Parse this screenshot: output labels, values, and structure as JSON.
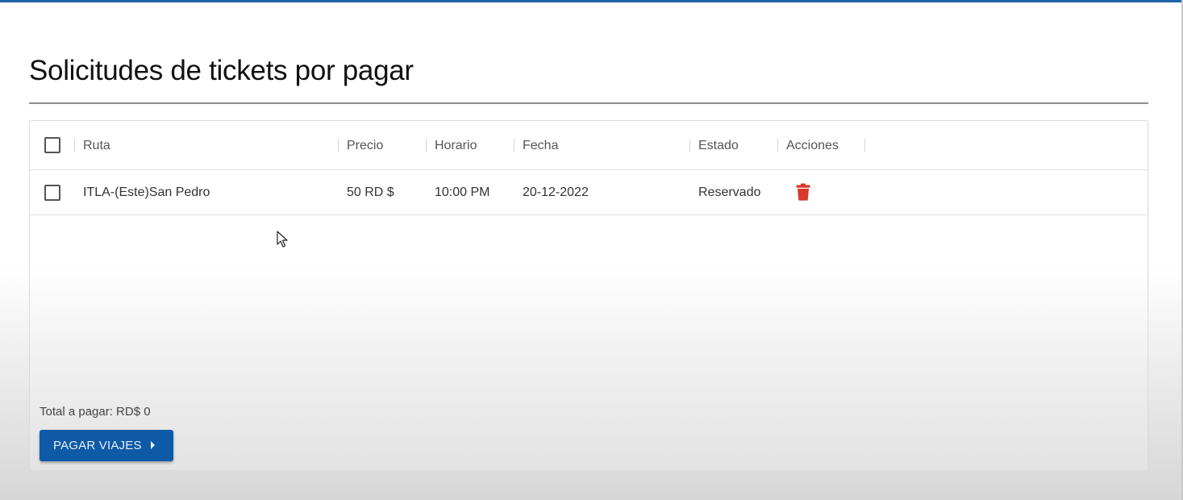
{
  "page": {
    "title": "Solicitudes de tickets por pagar"
  },
  "table": {
    "columns": [
      "Ruta",
      "Precio",
      "Horario",
      "Fecha",
      "Estado",
      "Acciones"
    ],
    "rows": [
      {
        "ruta": "ITLA-(Este)San Pedro",
        "precio": "50 RD $",
        "horario": "10:00 PM",
        "fecha": "20-12-2022",
        "estado": "Reservado",
        "action_icon": "trash-icon"
      }
    ]
  },
  "footer": {
    "total_label": "Total a pagar: RD$ 0",
    "pay_button_label": "PAGAR VIAJES",
    "pay_button_icon": "caret-right-icon"
  },
  "colors": {
    "accent": "#1f62a8",
    "button": "#0f5aa6",
    "delete": "#d9372c"
  }
}
